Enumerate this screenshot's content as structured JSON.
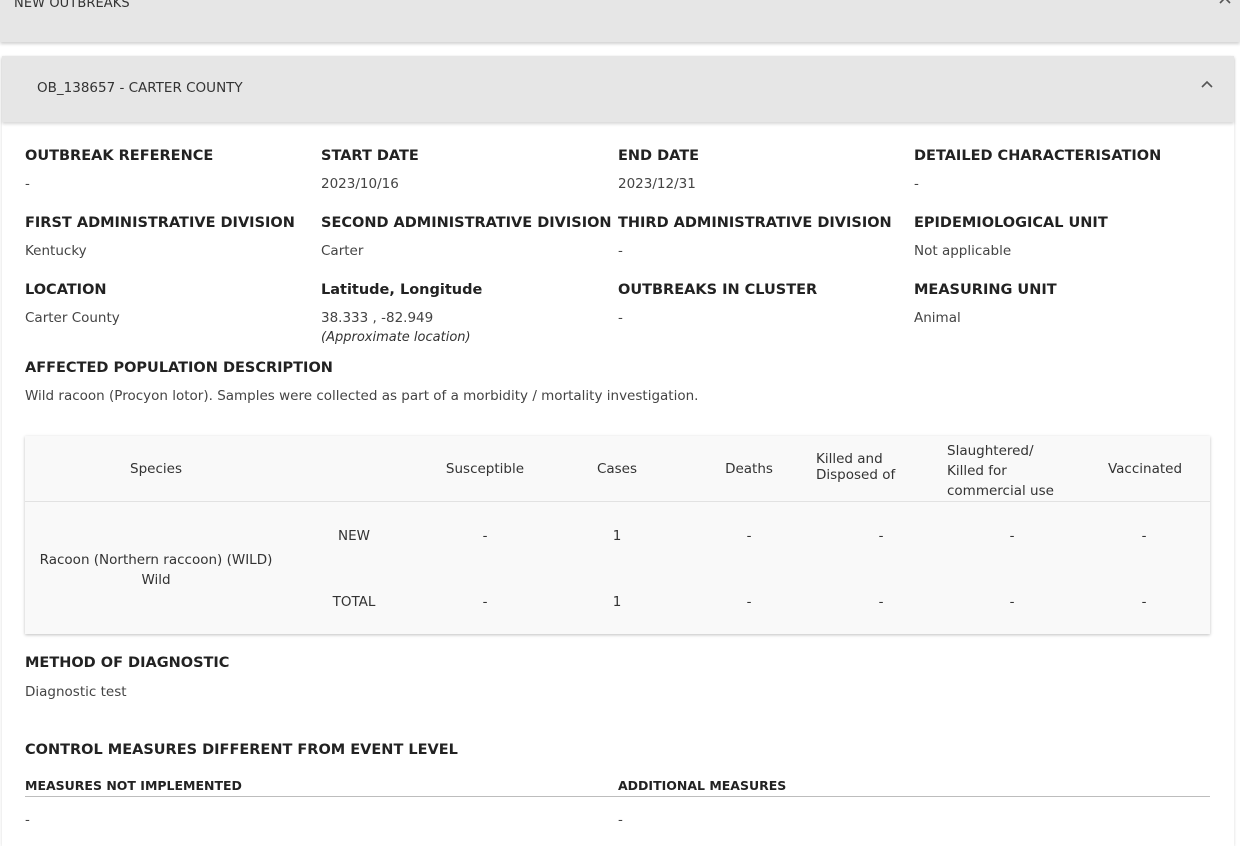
{
  "top_section": {
    "title": "NEW OUTBREAKS"
  },
  "outbreak": {
    "title": "OB_138657 - CARTER COUNTY",
    "fields": {
      "outbreak_reference": {
        "label": "OUTBREAK REFERENCE",
        "value": "-"
      },
      "start_date": {
        "label": "START DATE",
        "value": "2023/10/16"
      },
      "end_date": {
        "label": "END DATE",
        "value": "2023/12/31"
      },
      "detailed_characterisation": {
        "label": "DETAILED CHARACTERISATION",
        "value": "-"
      },
      "first_admin_division": {
        "label": "FIRST ADMINISTRATIVE DIVISION",
        "value": "Kentucky"
      },
      "second_admin_division": {
        "label": "SECOND ADMINISTRATIVE DIVISION",
        "value": "Carter"
      },
      "third_admin_division": {
        "label": "THIRD ADMINISTRATIVE DIVISION",
        "value": "-"
      },
      "epidemiological_unit": {
        "label": "EPIDEMIOLOGICAL UNIT",
        "value": "Not applicable"
      },
      "location": {
        "label": "LOCATION",
        "value": "Carter County"
      },
      "lat_long": {
        "label": "Latitude, Longitude",
        "value": "38.333 , -82.949",
        "note": "(Approximate location)"
      },
      "outbreaks_in_cluster": {
        "label": "OUTBREAKS IN CLUSTER",
        "value": "-"
      },
      "measuring_unit": {
        "label": "MEASURING UNIT",
        "value": "Animal"
      }
    },
    "affected_population": {
      "label": "AFFECTED POPULATION DESCRIPTION",
      "value": "Wild racoon (Procyon lotor). Samples were collected as part of a morbidity / mortality investigation."
    },
    "population_table": {
      "headers": {
        "species": "Species",
        "susceptible": "Susceptible",
        "cases": "Cases",
        "deaths": "Deaths",
        "killed_line1": "Killed and",
        "killed_line2": "Disposed of",
        "slaughtered_line1": "Slaughtered/",
        "slaughtered_line2": "Killed for",
        "slaughtered_line3": "commercial use",
        "vaccinated": "Vaccinated"
      },
      "species_name": "Racoon (Northern raccoon) (WILD)",
      "species_type": "Wild",
      "rows": [
        {
          "label": "NEW",
          "susceptible": "-",
          "cases": "1",
          "deaths": "-",
          "killed": "-",
          "slaughtered": "-",
          "vaccinated": "-"
        },
        {
          "label": "TOTAL",
          "susceptible": "-",
          "cases": "1",
          "deaths": "-",
          "killed": "-",
          "slaughtered": "-",
          "vaccinated": "-"
        }
      ]
    },
    "method_of_diagnostic": {
      "label": "METHOD OF DIAGNOSTIC",
      "value": "Diagnostic test"
    },
    "control_measures": {
      "label": "CONTROL MEASURES DIFFERENT FROM EVENT LEVEL",
      "not_implemented_label": "MEASURES NOT IMPLEMENTED",
      "not_implemented_value": "-",
      "additional_label": "ADDITIONAL MEASURES",
      "additional_value": "-"
    }
  }
}
